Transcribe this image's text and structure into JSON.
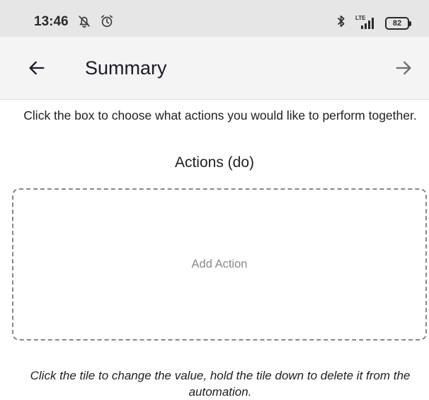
{
  "status_bar": {
    "time": "13:46",
    "icons": [
      "notifications-off-icon",
      "alarm-icon",
      "bluetooth-icon",
      "lte-signal-icon",
      "battery-icon"
    ],
    "network_label": "LTE",
    "battery_level": "82"
  },
  "app_bar": {
    "title": "Summary",
    "back_icon": "arrow-left-icon",
    "forward_icon": "arrow-right-icon"
  },
  "main": {
    "instruction": "Click the box to choose what actions you would like to perform together.",
    "section_title": "Actions (do)",
    "add_action_label": "Add Action",
    "footer_note": "Click the tile to change the value, hold the tile down to delete it from the automation."
  },
  "colors": {
    "status_bar_bg": "#e6e6e6",
    "app_bar_bg": "#f4f4f4",
    "placeholder_text": "#8a8a8a",
    "dashed_border": "#888888"
  }
}
